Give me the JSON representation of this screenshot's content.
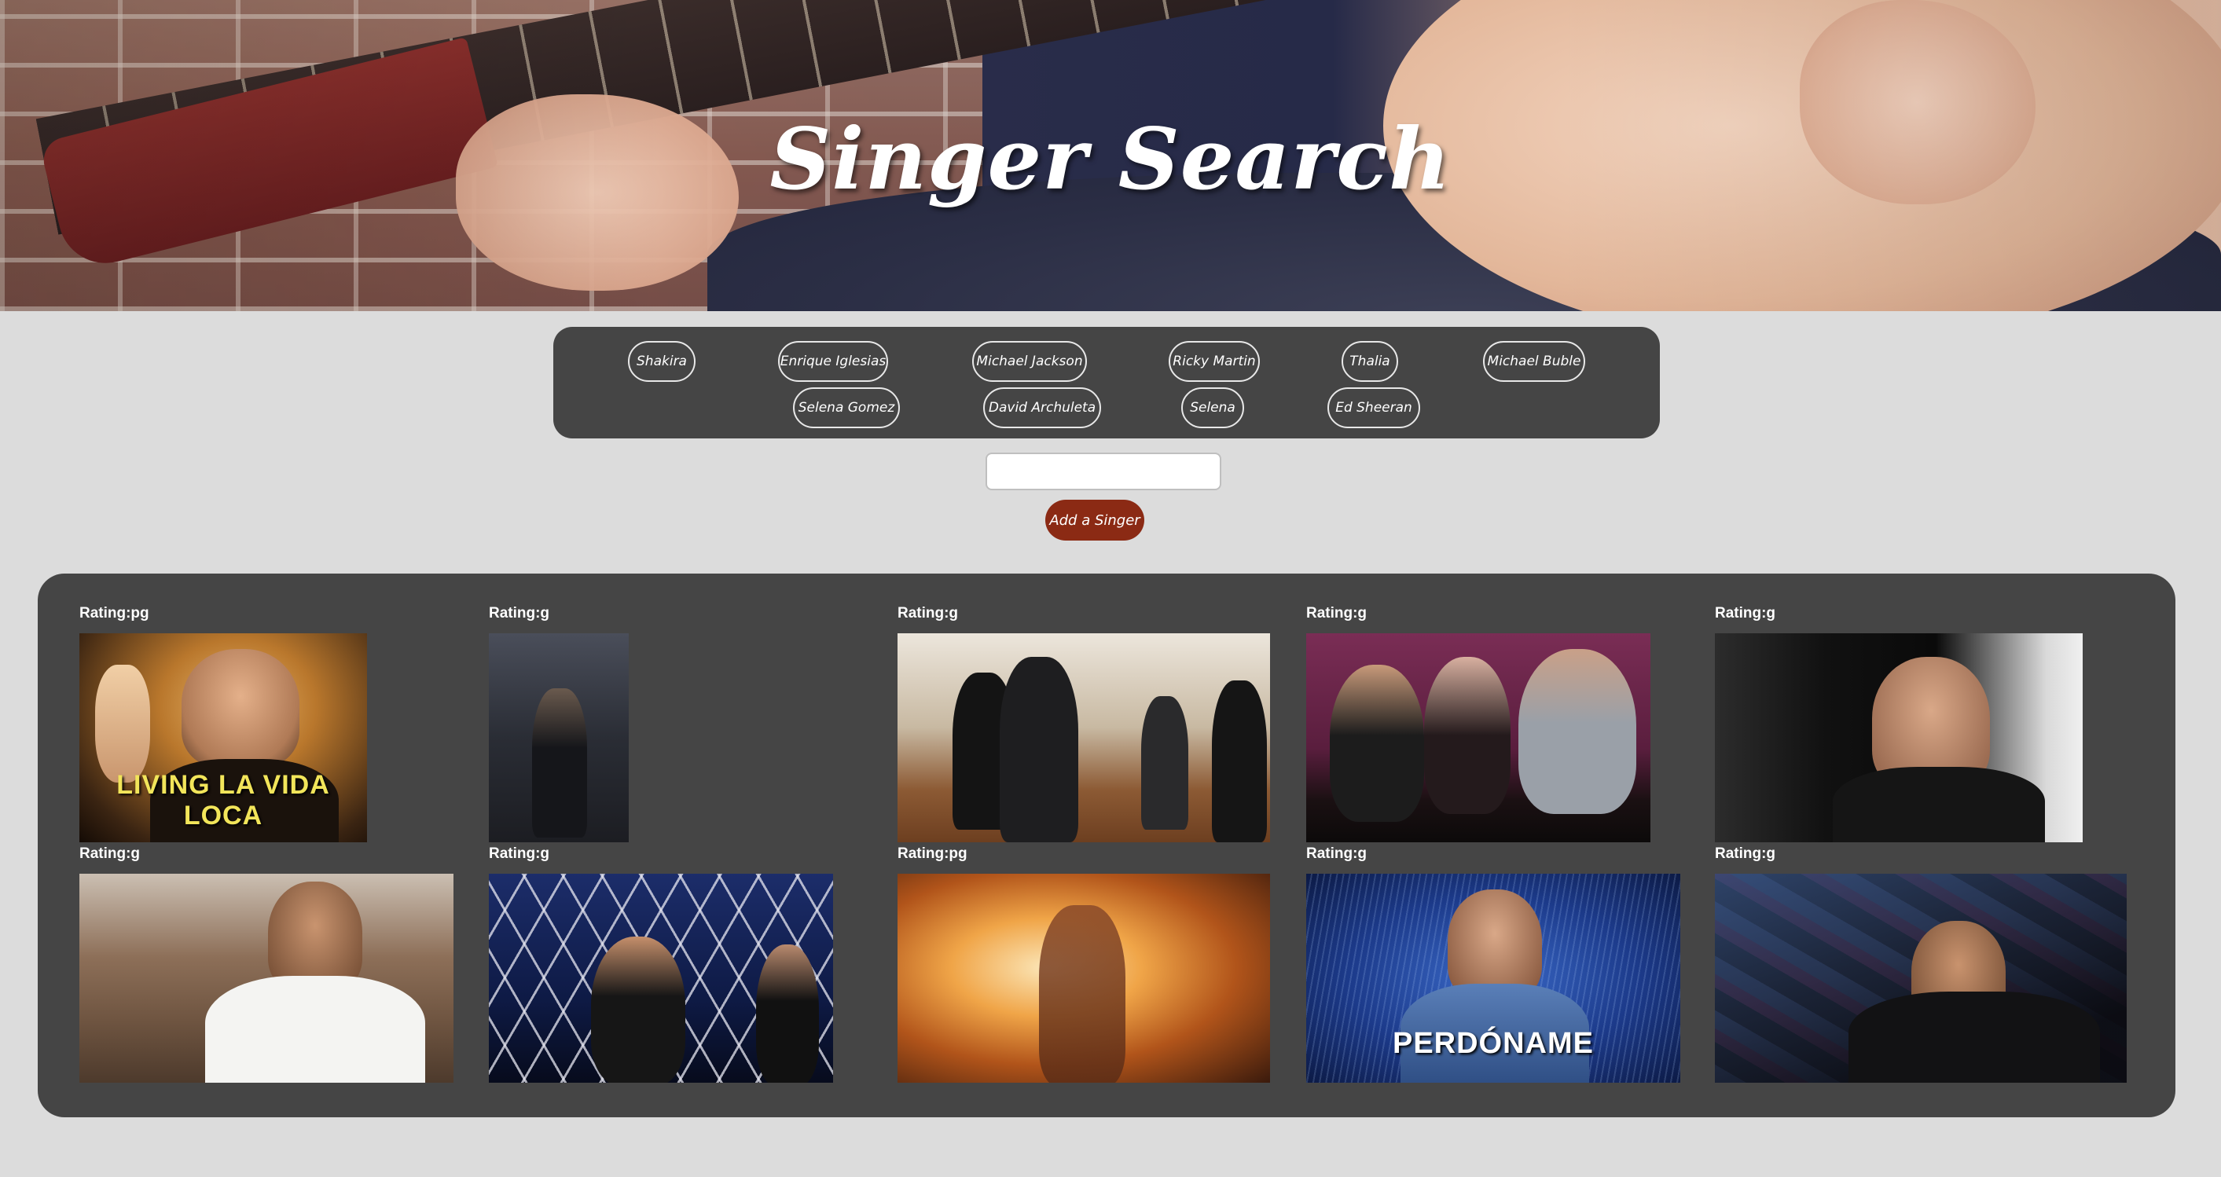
{
  "header": {
    "title": "Singer Search"
  },
  "singers": [
    "Shakira",
    "Enrique Iglesias",
    "Michael Jackson",
    "Ricky Martin",
    "Thalia",
    "Michael Buble",
    "Selena Gomez",
    "David Archuleta",
    "Selena",
    "Ed Sheeran"
  ],
  "search": {
    "value": "",
    "placeholder": ""
  },
  "add_button": {
    "label": "Add a Singer"
  },
  "gifs": [
    {
      "rating": "Rating:pg",
      "caption": "LIVING LA VIDA LOCA"
    },
    {
      "rating": "Rating:g",
      "caption": ""
    },
    {
      "rating": "Rating:g",
      "caption": ""
    },
    {
      "rating": "Rating:g",
      "caption": ""
    },
    {
      "rating": "Rating:g",
      "caption": ""
    },
    {
      "rating": "Rating:g",
      "caption": ""
    },
    {
      "rating": "Rating:g",
      "caption": ""
    },
    {
      "rating": "Rating:pg",
      "caption": ""
    },
    {
      "rating": "Rating:g",
      "caption": "PERDÓNAME"
    },
    {
      "rating": "Rating:g",
      "caption": ""
    }
  ],
  "colors": {
    "page_bg": "#dcdcdc",
    "panel_bg": "#454545",
    "add_button_bg": "#8b2a14",
    "button_border": "#e8e8e8"
  }
}
